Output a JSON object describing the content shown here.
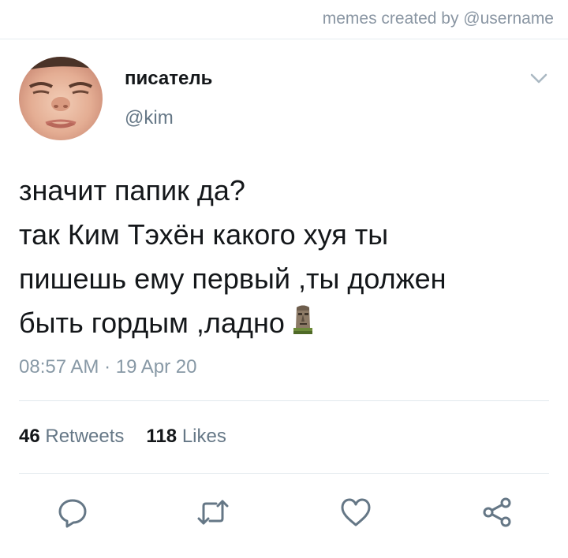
{
  "watermark": "memes created by @username",
  "tweet": {
    "display_name": "писатель",
    "handle": "@kim",
    "text_lines": [
      "значит папик да?",
      "так Ким Тэхён какого хуя ты",
      "пишешь ему первый ,ты должен",
      "быть гордым ,ладно"
    ],
    "emoji": "moai-icon",
    "timestamp": "08:57 AM · 19 Apr 20"
  },
  "stats": {
    "retweets_count": "46",
    "retweets_label": "Retweets",
    "likes_count": "118",
    "likes_label": "Likes"
  },
  "actions": [
    "reply-icon",
    "retweet-icon",
    "like-icon",
    "share-icon"
  ],
  "colors": {
    "text": "#14171a",
    "secondary": "#657786",
    "muted": "#8899a6",
    "divider": "#e1e8ed",
    "icon": "#657786"
  }
}
